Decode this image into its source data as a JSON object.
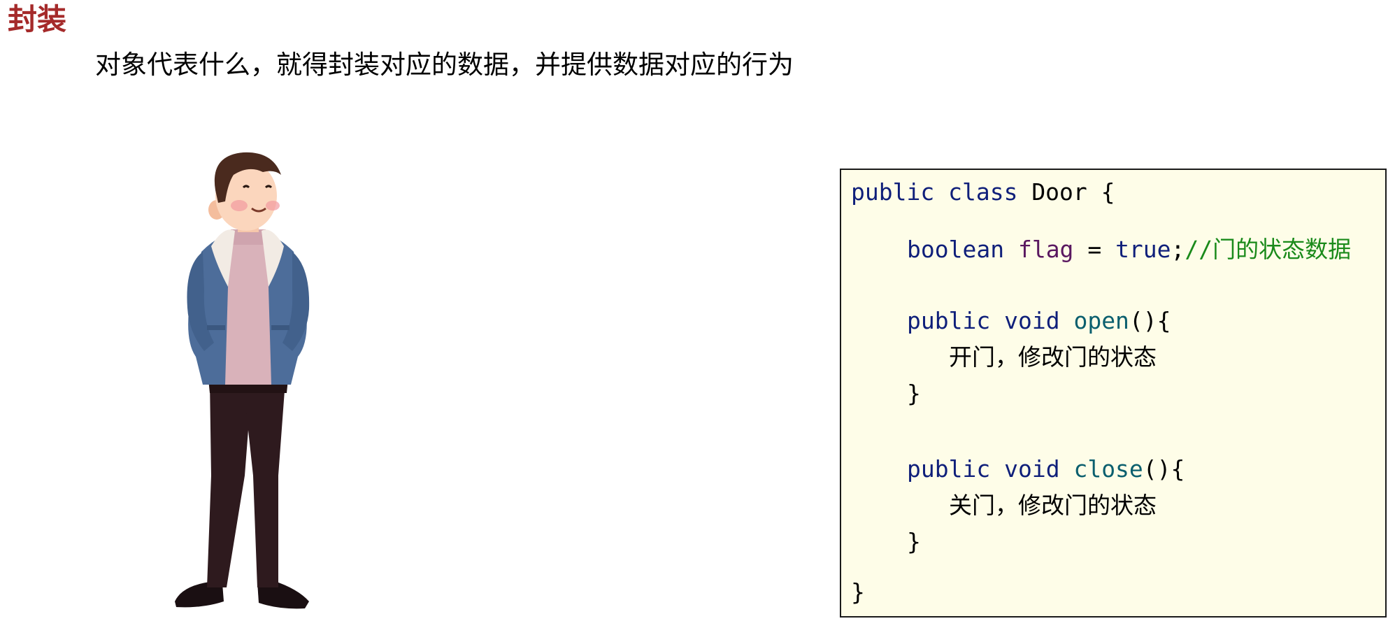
{
  "slide": {
    "title": "封装",
    "subtitle": "对象代表什么，就得封装对应的数据，并提供数据对应的行为"
  },
  "code": {
    "line1": {
      "kw1": "public",
      "kw2": "class",
      "name": "Door",
      "brace": "{"
    },
    "line2": {
      "type": "boolean",
      "var": "flag",
      "eq": "=",
      "val": "true",
      "semi": ";",
      "comment": "//门的状态数据"
    },
    "line3": {
      "kw1": "public",
      "kw2": "void",
      "method": "open",
      "rest": "(){"
    },
    "line4": {
      "text": "开门，修改门的状态"
    },
    "line5": {
      "brace": "}"
    },
    "line6": {
      "kw1": "public",
      "kw2": "void",
      "method": "close",
      "rest": "(){"
    },
    "line7": {
      "text": "关门，修改门的状态"
    },
    "line8": {
      "brace": "}"
    },
    "line9": {
      "brace": "}"
    }
  },
  "colors": {
    "title": "#a52a2a",
    "keyword": "#0f1f7a",
    "variable": "#5a1860",
    "method": "#0b5f6e",
    "comment": "#1a8a1a",
    "code_background": "#fefde8"
  },
  "illustration": {
    "icon": "standing-man-illustration"
  }
}
